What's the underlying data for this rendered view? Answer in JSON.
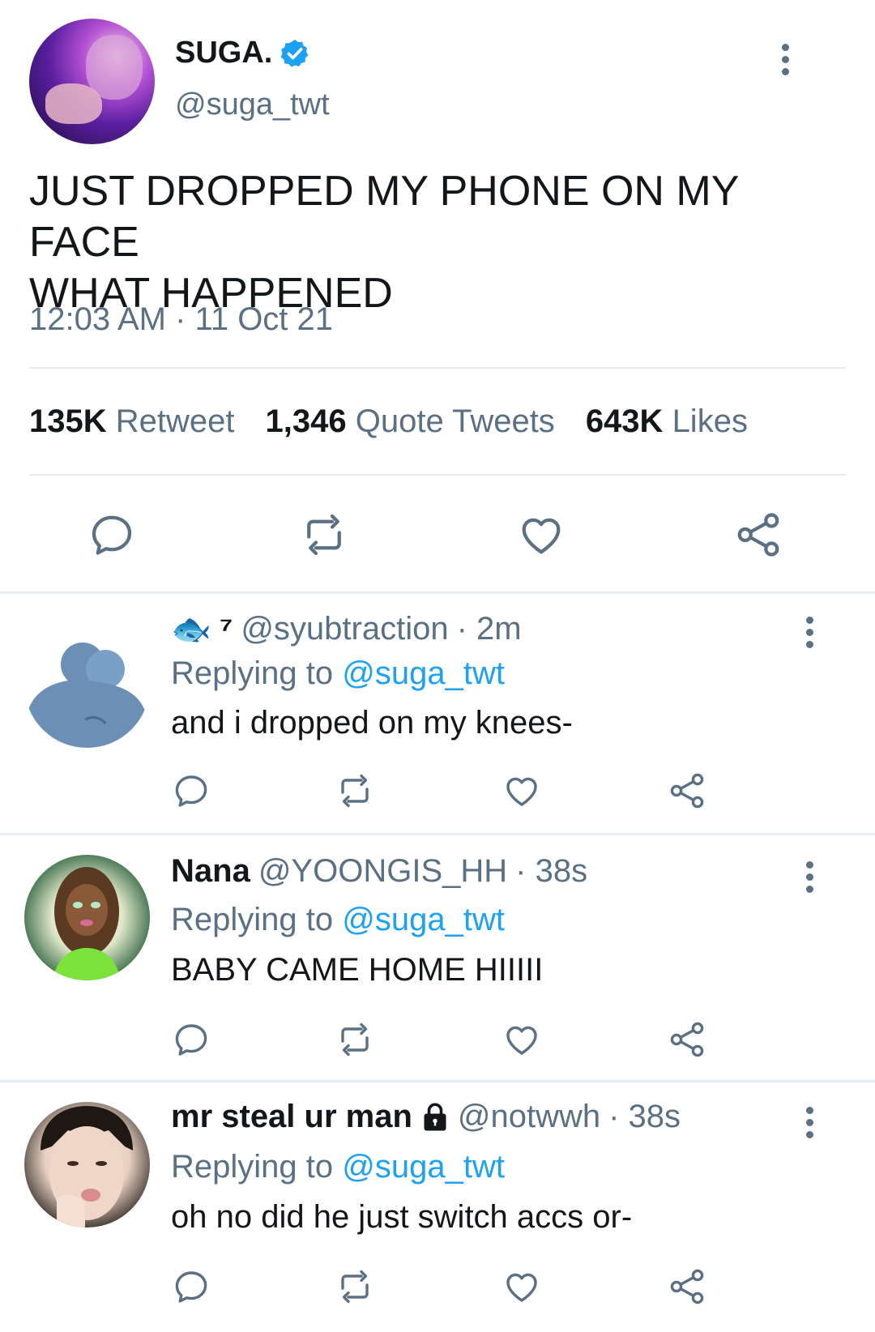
{
  "main_tweet": {
    "display_name": "SUGA.",
    "verified": true,
    "handle": "@suga_twt",
    "text_line1": "JUST DROPPED MY PHONE ON MY FACE",
    "text_line2": "WHAT HAPPENED",
    "timestamp": "12:03 AM · 11 Oct 21",
    "stats": {
      "retweets_count": "135K",
      "retweets_label": "Retweet",
      "quotes_count": "1,346",
      "quotes_label": "Quote Tweets",
      "likes_count": "643K",
      "likes_label": "Likes"
    },
    "actions": [
      "reply-icon",
      "retweet-icon",
      "like-icon",
      "share-icon"
    ]
  },
  "replies": [
    {
      "name_emoji": "🐟",
      "name_suffix": "⁷",
      "handle": "@syubtraction",
      "time": "· 2m",
      "replying_prefix": "Replying to",
      "replying_to": "@suga_twt",
      "text": "and i dropped on my knees-"
    },
    {
      "name": "Nana",
      "handle": "@YOONGIS_HH",
      "time": "· 38s",
      "replying_prefix": "Replying to",
      "replying_to": "@suga_twt",
      "text": "BABY CAME HOME HIIIII"
    },
    {
      "name": "mr steal ur man",
      "protected": true,
      "handle": "@notwwh",
      "time": "· 38s",
      "replying_prefix": "Replying to",
      "replying_to": "@suga_twt",
      "text": "oh no did he just switch accs or-"
    }
  ],
  "colors": {
    "accent": "#1da1f2",
    "secondary_text": "#5b7083",
    "divider": "#e6ecf0"
  }
}
